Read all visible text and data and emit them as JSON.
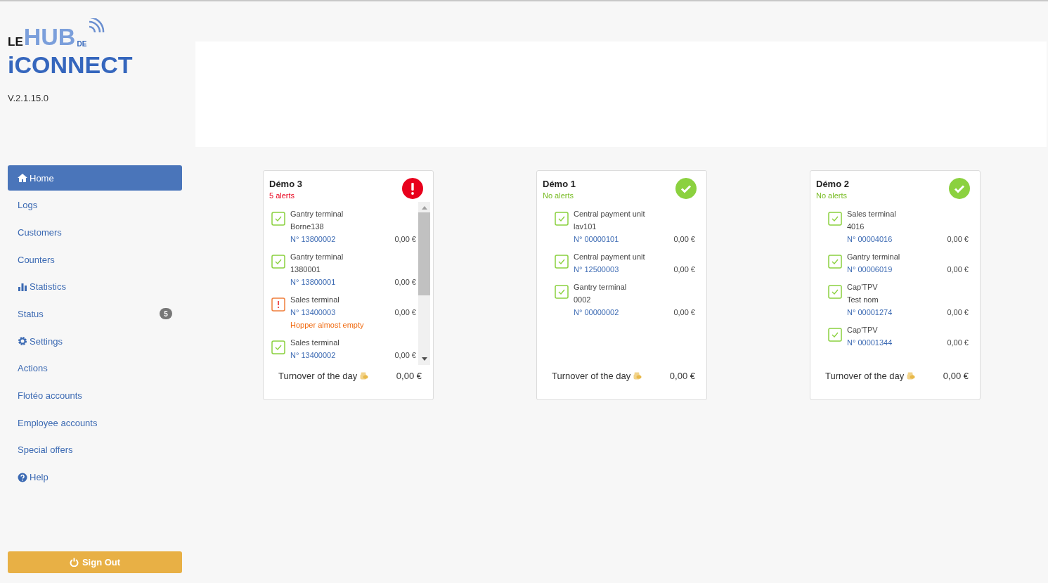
{
  "logo": {
    "le": "LE",
    "hub": "HUB",
    "de": "DE",
    "connect": "iCONNECT"
  },
  "version": "V.2.1.15.0",
  "nav": [
    {
      "label": "Home",
      "kind": "home",
      "selected": true
    },
    {
      "label": "Logs",
      "selected": false
    },
    {
      "label": "Customers",
      "selected": false
    },
    {
      "label": "Counters",
      "selected": false
    },
    {
      "label": "Statistics",
      "kind": "chart",
      "selected": false
    },
    {
      "label": "Status",
      "badge": "5",
      "selected": false
    },
    {
      "label": "Settings",
      "kind": "gear",
      "selected": false
    },
    {
      "label": "Actions",
      "selected": false
    },
    {
      "label": "Flotéo accounts",
      "selected": false
    },
    {
      "label": "Employee accounts",
      "selected": false
    },
    {
      "label": "Special offers",
      "selected": false
    },
    {
      "label": "Help",
      "kind": "help",
      "selected": false
    }
  ],
  "sign_out": "Sign Out",
  "sites": [
    {
      "name": "Démo 3",
      "kind": "alert",
      "summary": "5 alerts",
      "scrollbar": true,
      "turnover_label": "Turnover of the day",
      "turnover": "0,00 €",
      "devices": [
        {
          "kind": "ok",
          "type": "Gantry terminal",
          "name": "Borne138",
          "number": "N° 13800002",
          "amount": "0,00 €"
        },
        {
          "kind": "ok",
          "type": "Gantry terminal",
          "name": "1380001",
          "number": "N° 13800001",
          "amount": "0,00 €"
        },
        {
          "kind": "alert",
          "type": "Sales terminal",
          "number": "N° 13400003",
          "amount": "0,00 €",
          "message": "Hopper almost empty"
        },
        {
          "kind": "ok",
          "type": "Sales terminal",
          "number": "N° 13400002",
          "amount": "0,00 €"
        }
      ]
    },
    {
      "name": "Démo 1",
      "kind": "ok",
      "summary": "No alerts",
      "scrollbar": false,
      "turnover_label": "Turnover of the day",
      "turnover": "0,00 €",
      "devices": [
        {
          "kind": "ok",
          "type": "Central payment unit",
          "name": "lav101",
          "number": "N° 00000101",
          "amount": "0,00 €"
        },
        {
          "kind": "ok",
          "type": "Central payment unit",
          "number": "N° 12500003",
          "amount": "0,00 €"
        },
        {
          "kind": "ok",
          "type": "Gantry terminal",
          "name": "0002",
          "number": "N° 00000002",
          "amount": "0,00 €"
        }
      ]
    },
    {
      "name": "Démo 2",
      "kind": "ok",
      "summary": "No alerts",
      "scrollbar": false,
      "turnover_label": "Turnover of the day",
      "turnover": "0,00 €",
      "devices": [
        {
          "kind": "ok",
          "type": "Sales terminal",
          "name": "4016",
          "number": "N° 00004016",
          "amount": "0,00 €"
        },
        {
          "kind": "ok",
          "type": "Gantry terminal",
          "number": "N° 00006019",
          "amount": "0,00 €"
        },
        {
          "kind": "ok",
          "type": "Cap'TPV",
          "name": "Test nom",
          "number": "N° 00001274",
          "amount": "0,00 €"
        },
        {
          "kind": "ok",
          "type": "Cap'TPV",
          "number": "N° 00001344",
          "amount": "0,00 €"
        }
      ]
    }
  ]
}
